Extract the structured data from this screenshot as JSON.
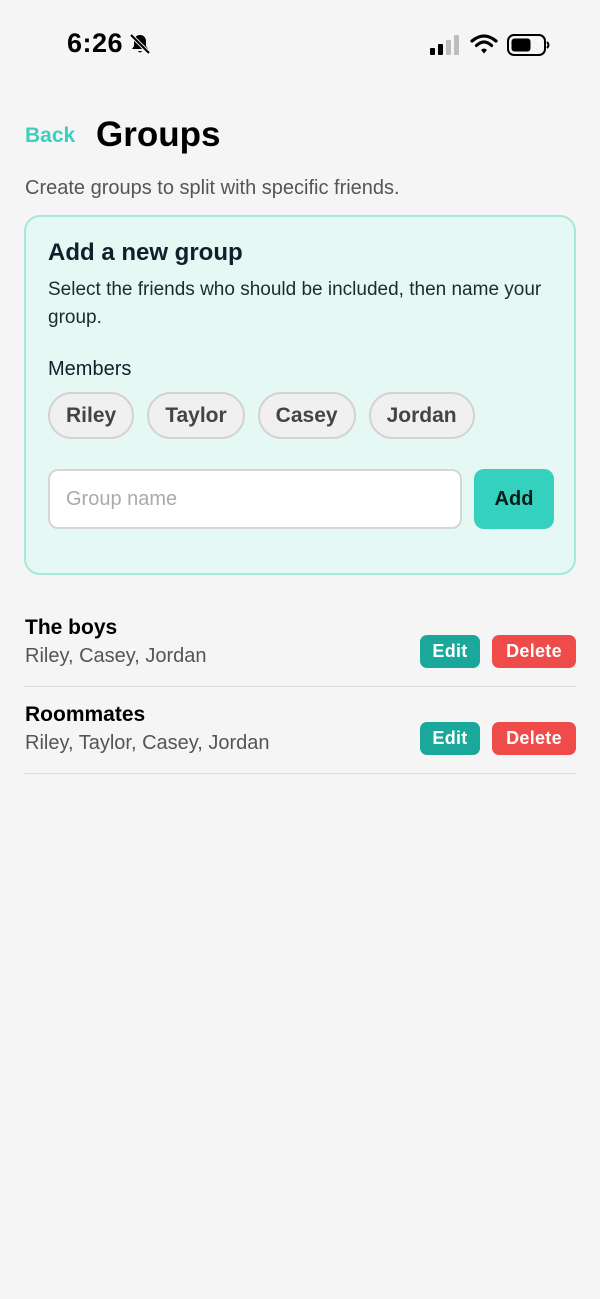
{
  "status_bar": {
    "time": "6:26",
    "icons": [
      "bell-slash-icon",
      "cellular-signal-icon",
      "wifi-icon",
      "battery-icon"
    ]
  },
  "header": {
    "back_label": "Back",
    "title": "Groups"
  },
  "subtitle": "Create groups to split with specific friends.",
  "new_group_card": {
    "title": "Add a new group",
    "description": "Select the friends who should be included, then name your group.",
    "members_label": "Members",
    "members": [
      "Riley",
      "Taylor",
      "Casey",
      "Jordan"
    ],
    "input_value": "",
    "input_placeholder": "Group name",
    "add_label": "Add"
  },
  "groups": [
    {
      "name": "The boys",
      "members": "Riley, Casey, Jordan",
      "edit_label": "Edit",
      "delete_label": "Delete"
    },
    {
      "name": "Roommates",
      "members": "Riley, Taylor, Casey, Jordan",
      "edit_label": "Edit",
      "delete_label": "Delete"
    }
  ],
  "colors": {
    "accent": "#3ccfbf",
    "add_button": "#34d1be",
    "edit_button": "#1aa89a",
    "delete_button": "#ef4b4b",
    "card_background": "#e6f8f4",
    "card_border": "#a6e9dc",
    "page_background": "#f5f5f5"
  }
}
